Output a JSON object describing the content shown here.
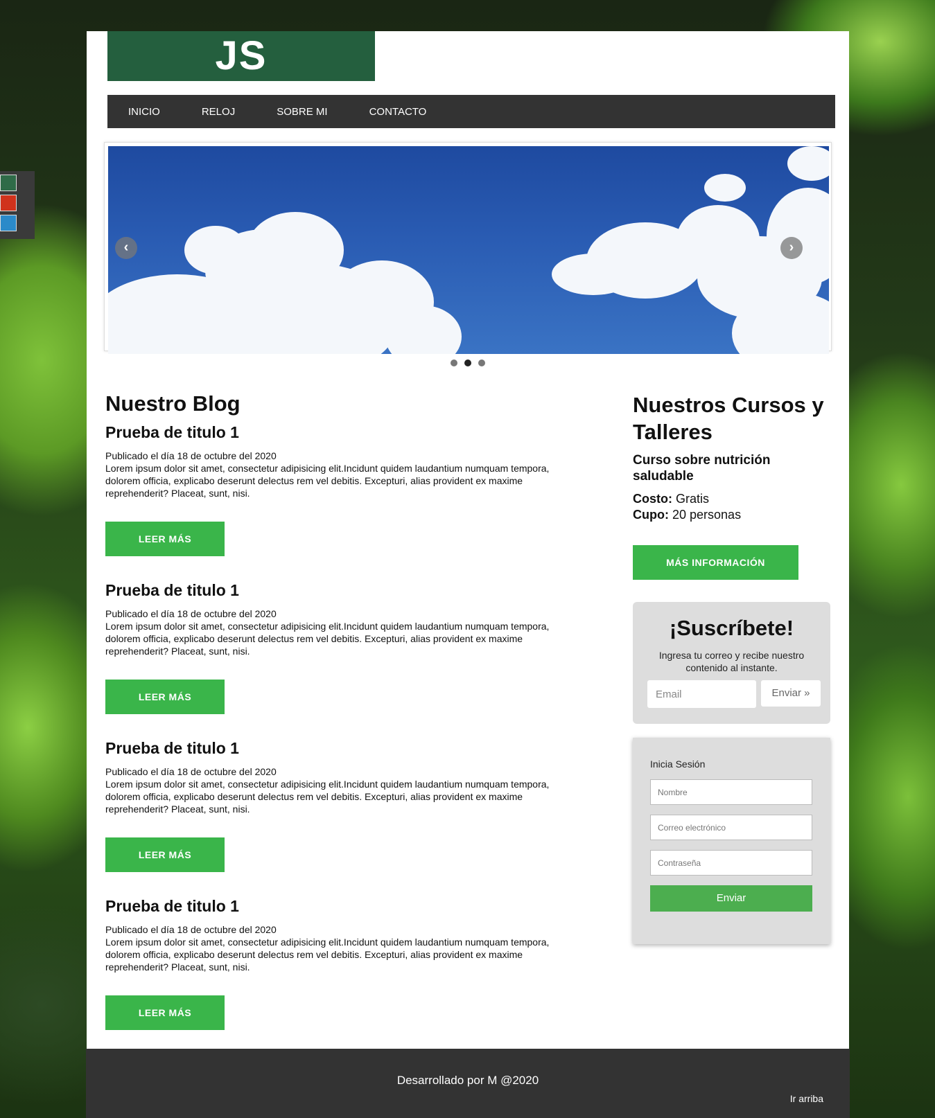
{
  "logo": "JS",
  "nav": [
    "INICIO",
    "RELOJ",
    "SOBRE MI",
    "CONTACTO"
  ],
  "colors": {
    "theme_swatches": [
      "#2f6b48",
      "#d0321c",
      "#2b8ac9"
    ],
    "accent_button": "#3ab54a",
    "logo_bg": "#245f3e",
    "nav_bg": "#333333"
  },
  "slider": {
    "prev_icon": "chevron-left-icon",
    "next_icon": "chevron-right-icon",
    "prev_glyph": "‹",
    "next_glyph": "›",
    "slides": 3,
    "active_slide": 2
  },
  "blog": {
    "heading": "Nuestro Blog",
    "posts": [
      {
        "title": "Prueba de titulo 1",
        "date": "Publicado el día 18 de octubre del 2020",
        "body": "Lorem ipsum dolor sit amet, consectetur adipisicing elit.Incidunt quidem laudantium numquam tempora, dolorem officia, explicabo deserunt delectus rem vel debitis. Excepturi, alias provident ex maxime reprehenderit? Placeat, sunt, nisi.",
        "button": "LEER MÁS"
      },
      {
        "title": "Prueba de titulo 1",
        "date": "Publicado el día 18 de octubre del 2020",
        "body": "Lorem ipsum dolor sit amet, consectetur adipisicing elit.Incidunt quidem laudantium numquam tempora, dolorem officia, explicabo deserunt delectus rem vel debitis. Excepturi, alias provident ex maxime reprehenderit? Placeat, sunt, nisi.",
        "button": "LEER MÁS"
      },
      {
        "title": "Prueba de titulo 1",
        "date": "Publicado el día 18 de octubre del 2020",
        "body": "Lorem ipsum dolor sit amet, consectetur adipisicing elit.Incidunt quidem laudantium numquam tempora, dolorem officia, explicabo deserunt delectus rem vel debitis. Excepturi, alias provident ex maxime reprehenderit? Placeat, sunt, nisi.",
        "button": "LEER MÁS"
      },
      {
        "title": "Prueba de titulo 1",
        "date": "Publicado el día 18 de octubre del 2020",
        "body": "Lorem ipsum dolor sit amet, consectetur adipisicing elit.Incidunt quidem laudantium numquam tempora, dolorem officia, explicabo deserunt delectus rem vel debitis. Excepturi, alias provident ex maxime reprehenderit? Placeat, sunt, nisi.",
        "button": "LEER MÁS"
      }
    ]
  },
  "aside": {
    "heading": "Nuestros Cursos y Talleres",
    "course_title": "Curso sobre nutrición saludable",
    "cost_label": "Costo:",
    "cost_value": "Gratis",
    "quota_label": "Cupo:",
    "quota_value": "20 personas",
    "more_button": "MÁS INFORMACIÓN"
  },
  "subscribe": {
    "heading": "¡Suscríbete!",
    "text": "Ingresa tu correo y recibe nuestro contenido al instante.",
    "email_placeholder": "Email",
    "email_value": "",
    "send_button": "Enviar »"
  },
  "login": {
    "title": "Inicia Sesión",
    "name_placeholder": "Nombre",
    "email_placeholder": "Correo electrónico",
    "password_placeholder": "Contraseña",
    "submit": "Enviar"
  },
  "footer": {
    "credit": "Desarrollado por M @2020",
    "top_link": "Ir arriba"
  }
}
